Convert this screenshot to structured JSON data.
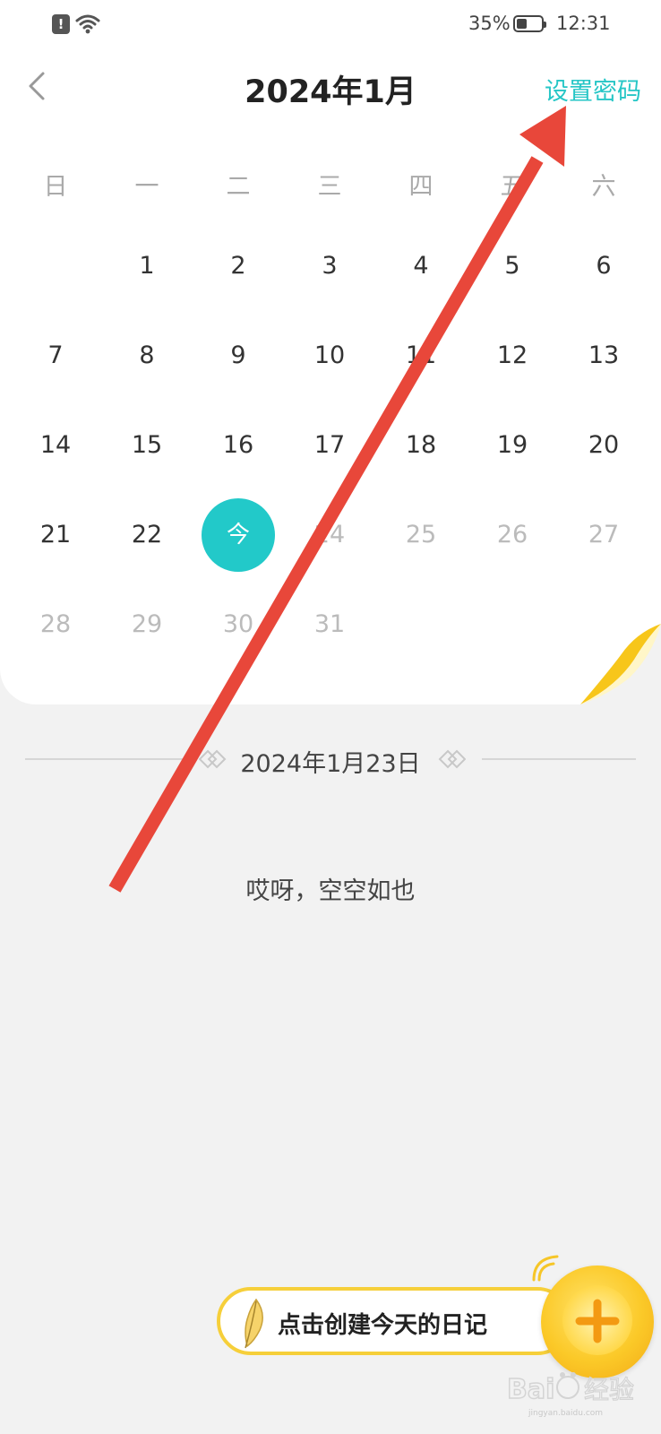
{
  "status_bar": {
    "alert_symbol": "!",
    "battery_percent": "35%",
    "time": "12:31"
  },
  "header": {
    "back_icon": "chevron-left-icon",
    "title": "2024年1月",
    "set_password": "设置密码"
  },
  "calendar": {
    "weekdays": [
      "日",
      "一",
      "二",
      "三",
      "四",
      "五",
      "六"
    ],
    "start_weekday": 1,
    "days": [
      "1",
      "2",
      "3",
      "4",
      "5",
      "6",
      "7",
      "8",
      "9",
      "10",
      "11",
      "12",
      "13",
      "14",
      "15",
      "16",
      "17",
      "18",
      "19",
      "20",
      "21",
      "22",
      "今",
      "24",
      "25",
      "26",
      "27",
      "28",
      "29",
      "30",
      "31"
    ],
    "today_index": 22,
    "accent_color": "#22c9c9"
  },
  "selected_date": "2024年1月23日",
  "empty_message": "哎呀，空空如也",
  "create_button": {
    "label": "点击创建今天的日记",
    "icon": "plus-icon"
  },
  "watermark": {
    "logo_text": "Bai 经验",
    "url": "jingyan.baidu.com"
  },
  "annotation": {
    "color": "#e8473a",
    "icon": "arrow-annotation"
  }
}
